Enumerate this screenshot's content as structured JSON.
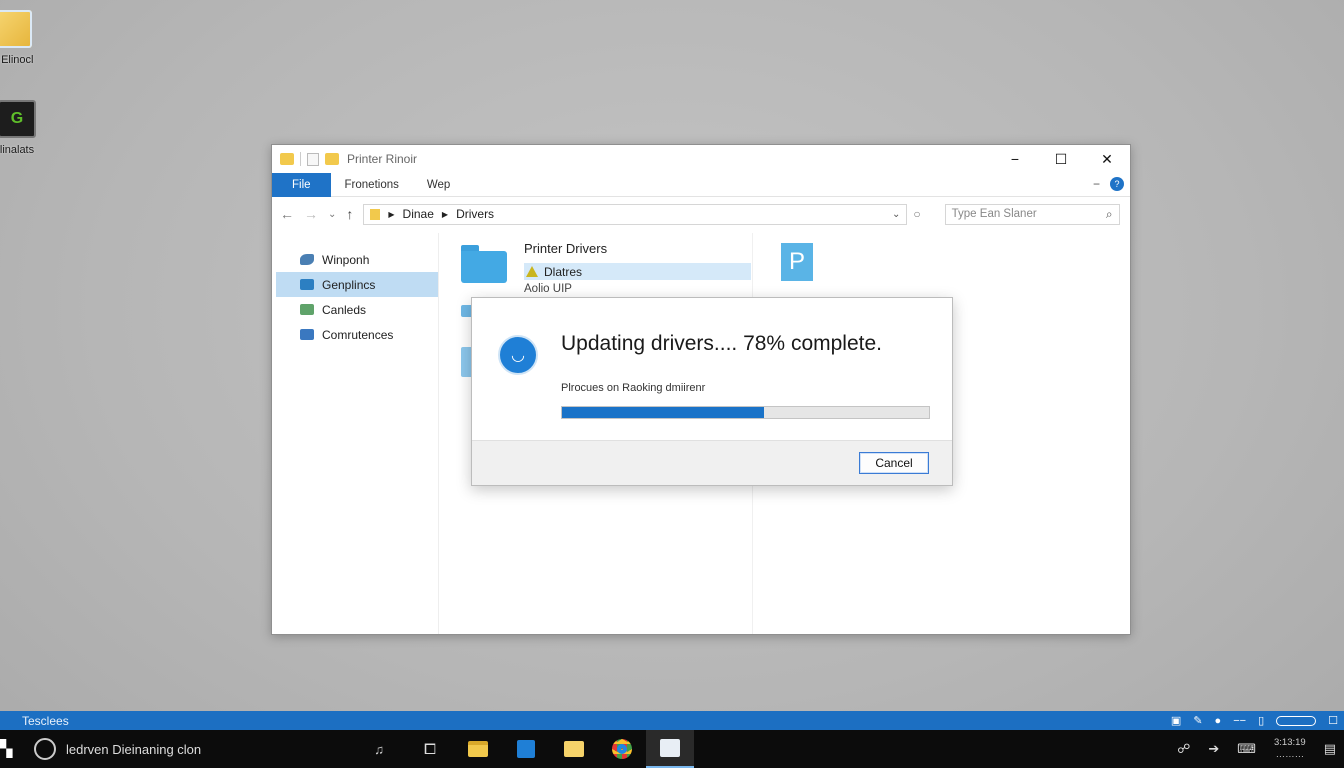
{
  "desktop": {
    "icons": [
      {
        "label": "y Elinocl",
        "icon": "folder-icon"
      },
      {
        "label": "linalats",
        "icon": "nvidia-icon"
      }
    ]
  },
  "window": {
    "title": "Printer Rinoir",
    "controls": {
      "minimize": "−",
      "maximize": "☐",
      "close": "✕"
    },
    "ribbon": {
      "tabs": [
        "File",
        "Fronetions",
        "Wep"
      ]
    },
    "address": {
      "path": [
        "Dinae",
        "Drivers"
      ]
    },
    "search": {
      "placeholder": "Type Ean Slaner"
    },
    "sidebar": {
      "items": [
        {
          "label": "Winponh",
          "selected": false
        },
        {
          "label": "Genplincs",
          "selected": true
        },
        {
          "label": "Canleds",
          "selected": false
        },
        {
          "label": "Comrutences",
          "selected": false
        }
      ]
    },
    "content": {
      "folder_title": "Printer Drivers",
      "file_name": "Dlatres",
      "sub_label": "Aolio UIP",
      "doc_letter": "P"
    }
  },
  "dialog": {
    "title": "Updating drivers.... 78% complete.",
    "subtitle": "Plrocues on Raoking dmiirenr",
    "progress": 0.55,
    "cancel_label": "Cancel"
  },
  "strip": {
    "label": "Tesclees"
  },
  "taskbar": {
    "search_text": "ledrven Dieinaning clon",
    "clock": {
      "time": "3:13:19",
      "date": "………"
    }
  },
  "colors": {
    "accent": "#1f73c7",
    "progress": "#1a73c8",
    "taskbar": "#0c0c0c"
  }
}
